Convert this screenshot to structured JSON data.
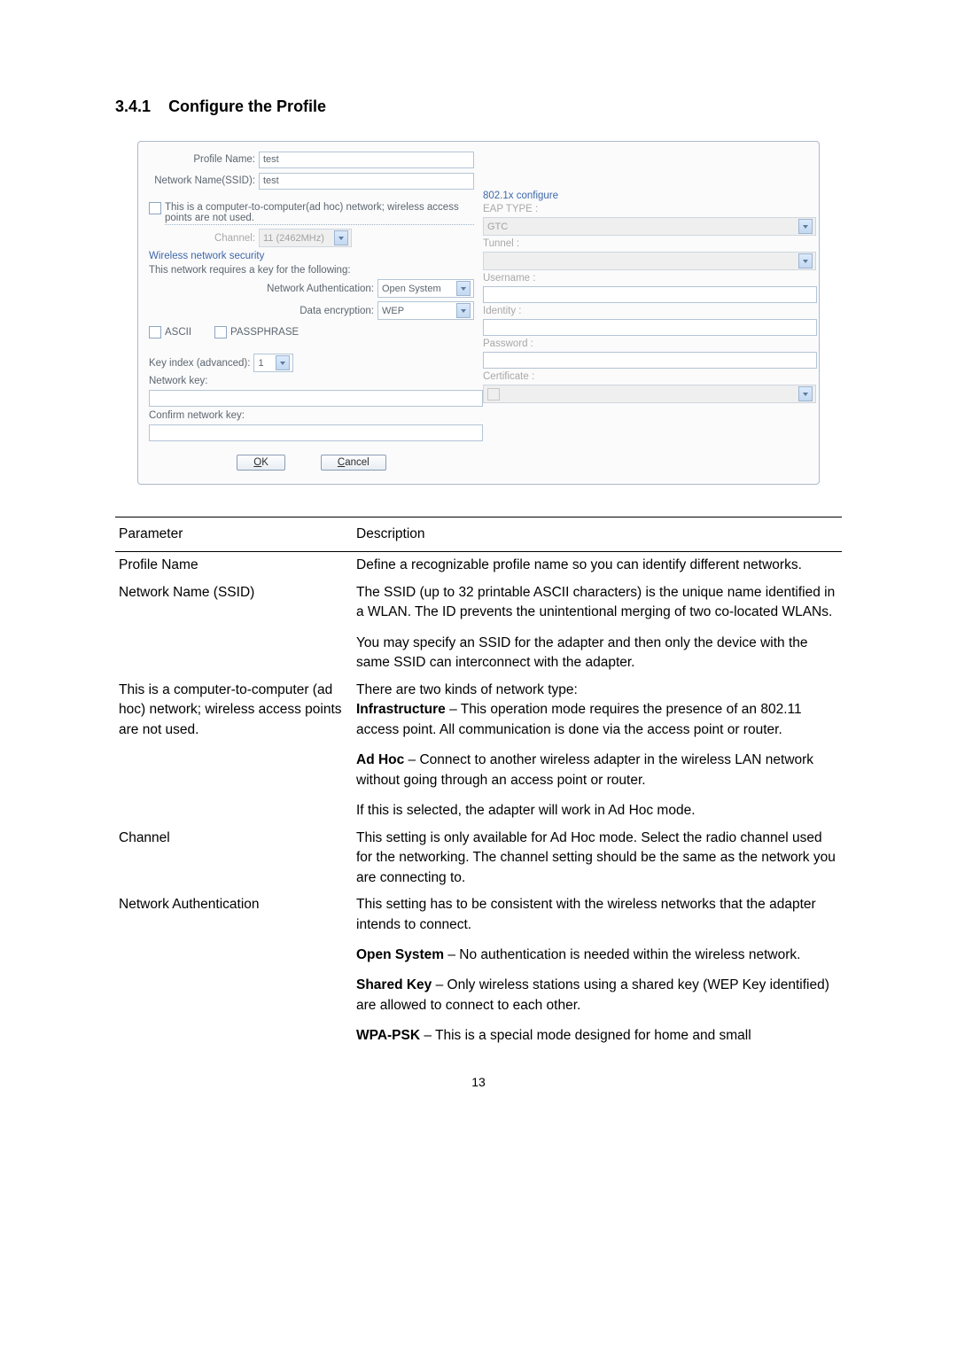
{
  "section": {
    "number": "3.4.1",
    "title": "Configure the Profile"
  },
  "dialog": {
    "profile_name_label": "Profile Name:",
    "profile_name_value": "test",
    "ssid_label": "Network Name(SSID):",
    "ssid_value": "test",
    "adhoc_label": "This is a computer-to-computer(ad hoc) network; wireless access points are not used.",
    "channel_label": "Channel:",
    "channel_value": "11 (2462MHz)",
    "wns_label": "Wireless network security",
    "requires_key_label": "This network requires a key for the following:",
    "net_auth_label": "Network Authentication:",
    "net_auth_value": "Open System",
    "data_enc_label": "Data encryption:",
    "data_enc_value": "WEP",
    "ascii_label": "ASCII",
    "passphrase_label": "PASSPHRASE",
    "key_index_label": "Key index (advanced):",
    "key_index_value": "1",
    "network_key_label": "Network key:",
    "confirm_key_label": "Confirm network key:",
    "ok_label": "OK",
    "cancel_label": "Cancel",
    "r_8021x_label": "802.1x configure",
    "r_eap_type_label": "EAP TYPE :",
    "r_eap_type_value": "GTC",
    "r_tunnel_label": "Tunnel :",
    "r_tunnel_value": "",
    "r_username_label": "Username :",
    "r_username_value": "",
    "r_identity_label": "Identity :",
    "r_identity_value": "",
    "r_password_label": "Password :",
    "r_password_value": "",
    "r_certificate_label": "Certificate :",
    "r_certificate_value": ""
  },
  "param_table": {
    "head_param": "Parameter",
    "head_desc": "Description",
    "rows": [
      {
        "param": "Profile Name",
        "desc": "Define a recognizable profile name so you can identify different networks."
      },
      {
        "param": "Network Name (SSID)",
        "desc": "The SSID (up to 32 printable ASCII characters) is the unique name identified in a WLAN. The ID prevents the unintentional merging of two co-located WLANs.",
        "extra": "You may specify an SSID for the adapter and then only the device with the same SSID can interconnect with the adapter."
      },
      {
        "param": "This is a computer-to-computer (ad hoc) network; wireless access points are not used.",
        "desc_lead": "There are two kinds of network type:",
        "desc_b1_label": "Infrastructure",
        "desc_b1_rest": " – This operation mode requires the presence of an 802.11 access point. All communication is done via the access point or router.",
        "desc_b2_label": "Ad Hoc",
        "desc_b2_rest": " – Connect to another wireless adapter in the wireless LAN network without going through an access point or router.",
        "desc_b3": "If this is selected, the adapter will work in Ad Hoc mode."
      },
      {
        "param": "Channel",
        "desc": "This setting is only available for Ad Hoc mode. Select the radio channel used for the networking. The channel setting should be the same as the network you are connecting to."
      },
      {
        "param": "Network Authentication",
        "desc": "This setting has to be consistent with the wireless networks that the adapter intends to connect.",
        "b1_label": "Open System",
        "b1_rest": " – No authentication is needed within the wireless network.",
        "b2_label": "Shared Key",
        "b2_rest": " – Only wireless stations using a shared key (WEP Key identified) are allowed to connect to each other.",
        "b3_label": "WPA-PSK",
        "b3_rest": " – This is a special mode designed for home and small"
      }
    ]
  },
  "page_number": "13"
}
